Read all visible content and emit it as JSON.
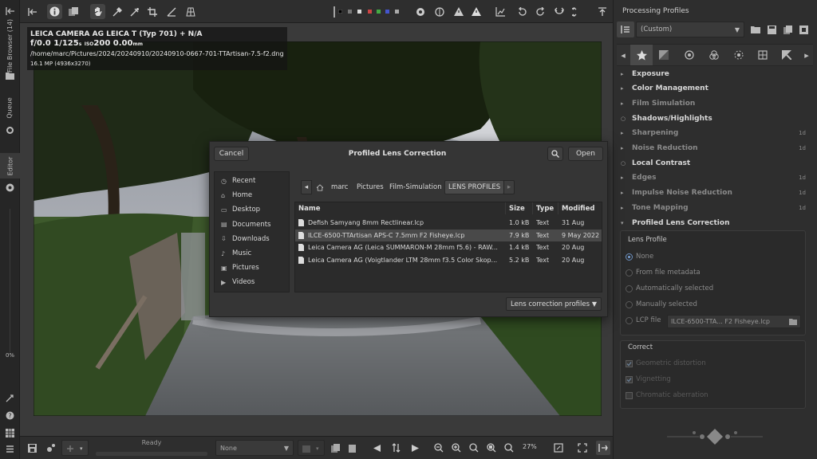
{
  "left_tabs": {
    "file_browser": "File Browser (14)",
    "queue": "Queue",
    "editor": "Editor",
    "percent": "0%"
  },
  "info_overlay": {
    "camera": "LEICA CAMERA AG LEICA T (Typ 701) + N/A",
    "exposure": {
      "aperture": "f/0.0",
      "shutter": "1/125",
      "shutter_unit": "s",
      "iso_label": "ISO",
      "iso": "200",
      "focal": "0.00",
      "focal_unit": "mm"
    },
    "path": "/home/marc/Pictures/2024/20240910/20240910-0667-701-TTArtisan-7.5-f2.dng",
    "size": "16.1 MP (4936x3270)"
  },
  "bottom_bar": {
    "status": "Ready",
    "profile_select": "None",
    "zoom": "27%"
  },
  "right_panel": {
    "title": "Processing Profiles",
    "profile": "(Custom)",
    "sections": [
      {
        "label": "Exposure",
        "arrow": "▸",
        "badge": "",
        "dim": false
      },
      {
        "label": "Color Management",
        "arrow": "▸",
        "badge": "",
        "dim": false
      },
      {
        "label": "Film Simulation",
        "arrow": "▸",
        "badge": "",
        "dim": true
      },
      {
        "label": "Shadows/Highlights",
        "arrow": "○",
        "badge": "",
        "dim": false
      },
      {
        "label": "Sharpening",
        "arrow": "▸",
        "badge": "1d",
        "dim": true
      },
      {
        "label": "Noise Reduction",
        "arrow": "▸",
        "badge": "1d",
        "dim": true
      },
      {
        "label": "Local Contrast",
        "arrow": "○",
        "badge": "",
        "dim": false
      },
      {
        "label": "Edges",
        "arrow": "▸",
        "badge": "1d",
        "dim": true
      },
      {
        "label": "Impulse Noise Reduction",
        "arrow": "▸",
        "badge": "1d",
        "dim": true
      },
      {
        "label": "Tone Mapping",
        "arrow": "▸",
        "badge": "1d",
        "dim": true
      },
      {
        "label": "Profiled Lens Correction",
        "arrow": "▾",
        "badge": "",
        "dim": false
      }
    ],
    "lens_profile": {
      "label": "Lens Profile",
      "options": [
        "None",
        "From file metadata",
        "Automatically selected",
        "Manually selected"
      ],
      "lcp_label": "LCP file",
      "lcp_value": "ILCE-6500-TTA... F2 Fisheye.lcp"
    },
    "correct": {
      "label": "Correct",
      "items": [
        {
          "label": "Geometric distortion",
          "checked": true
        },
        {
          "label": "Vignetting",
          "checked": true
        },
        {
          "label": "Chromatic aberration",
          "checked": false
        }
      ]
    }
  },
  "dialog": {
    "title": "Profiled Lens Correction",
    "cancel": "Cancel",
    "open": "Open",
    "places": [
      "Recent",
      "Home",
      "Desktop",
      "Documents",
      "Downloads",
      "Music",
      "Pictures",
      "Videos"
    ],
    "place_icons": [
      "◷",
      "⌂",
      "▭",
      "▤",
      "⇩",
      "♪",
      "▣",
      "▶"
    ],
    "path": [
      "marc",
      "Pictures",
      "Film-Simulation",
      "LENS PROFILES"
    ],
    "columns": [
      "Name",
      "Size",
      "Type",
      "Modified"
    ],
    "files": [
      {
        "name": "Defish Samyang 8mm Rectlinear.lcp",
        "size": "1.0 kB",
        "type": "Text",
        "modified": "31 Aug",
        "selected": false
      },
      {
        "name": "ILCE-6500-TTArtisan APS-C 7.5mm F2 Fisheye.lcp",
        "size": "7.9 kB",
        "type": "Text",
        "modified": "9 May 2022",
        "selected": true
      },
      {
        "name": "Leica Camera AG (Leica SUMMARON-M 28mm f5.6) - RAW...",
        "size": "1.4 kB",
        "type": "Text",
        "modified": "20 Aug",
        "selected": false
      },
      {
        "name": "Leica Camera AG (Voigtlander LTM 28mm f3.5 Color Skop...",
        "size": "5.2 kB",
        "type": "Text",
        "modified": "20 Aug",
        "selected": false
      }
    ],
    "filter": "Lens correction profiles"
  }
}
